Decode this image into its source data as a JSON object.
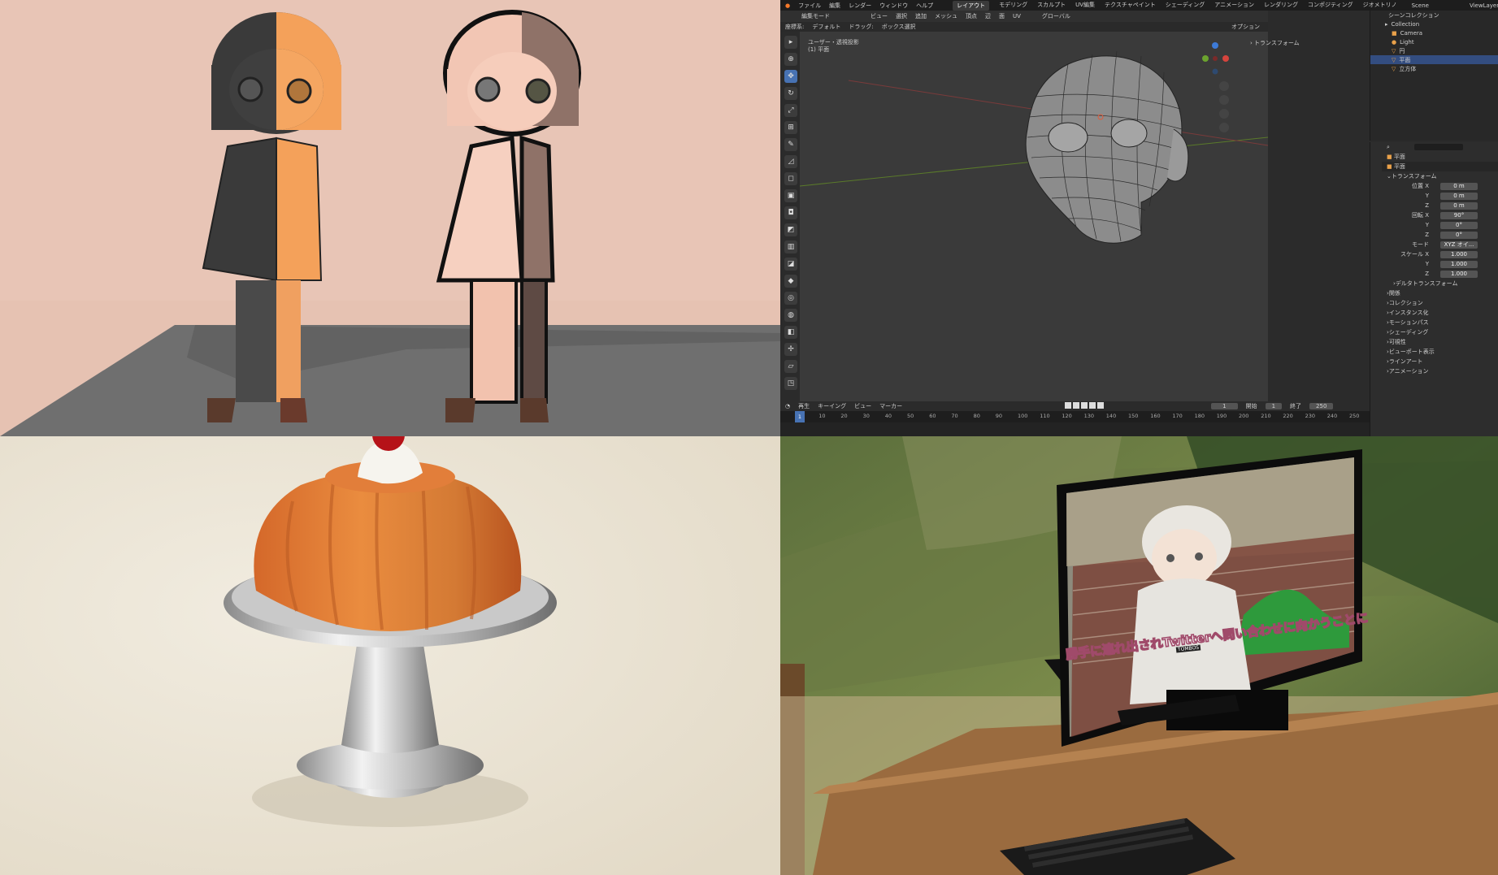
{
  "blender": {
    "menu": [
      "ファイル",
      "編集",
      "レンダー",
      "ウィンドウ",
      "ヘルプ"
    ],
    "workspaces": [
      "レイアウト",
      "モデリング",
      "スカルプト",
      "UV編集",
      "テクスチャペイント",
      "シェーディング",
      "アニメーション",
      "レンダリング",
      "コンポジティング",
      "ジオメトリノ"
    ],
    "active_workspace": "レイアウト",
    "scene": "Scene",
    "view_layer": "ViewLayer",
    "header_mode": "編集モード",
    "header_menus": [
      "ビュー",
      "選択",
      "追加",
      "メッシュ",
      "頂点",
      "辺",
      "面",
      "UV"
    ],
    "transform_orient": "グローバル",
    "header2": {
      "coord": "座標系:",
      "default": "デフォルト",
      "drag": "ドラッグ:",
      "box": "ボックス選択",
      "options": "オプション"
    },
    "viewport_label_1": "ユーザー・透視投影",
    "viewport_label_2": "(1) 平面",
    "transform_panel": "トランスフォーム",
    "outliner": {
      "title": "シーンコレクション",
      "items": [
        "Collection",
        "Camera",
        "Light",
        "円",
        "平面",
        "立方体"
      ]
    },
    "props": {
      "search": "",
      "object": "平面",
      "data_name": "平面",
      "section": "トランスフォーム",
      "loc_x_lab": "位置 X",
      "loc_x": "0 m",
      "loc_y_lab": "Y",
      "loc_y": "0 m",
      "loc_z_lab": "Z",
      "loc_z": "0 m",
      "rot_x_lab": "回転 X",
      "rot_x": "90°",
      "rot_y_lab": "Y",
      "rot_y": "0°",
      "rot_z_lab": "Z",
      "rot_z": "0°",
      "mode_lab": "モード",
      "mode": "XYZ オイ...",
      "scale_x_lab": "スケール X",
      "scale_x": "1.000",
      "scale_y_lab": "Y",
      "scale_y": "1.000",
      "scale_z_lab": "Z",
      "scale_z": "1.000",
      "sections": [
        "デルタトランスフォーム",
        "関係",
        "コレクション",
        "インスタンス化",
        "モーションパス",
        "シェーディング",
        "可視性",
        "ビューポート表示",
        "ラインアート",
        "アニメーション"
      ]
    },
    "timeline": {
      "menus": [
        "再生",
        "キーイング",
        "ビュー",
        "マーカー"
      ],
      "current": "1",
      "start_lab": "開始",
      "start": "1",
      "end_lab": "終了",
      "end": "250",
      "ticks": [
        "1",
        "10",
        "20",
        "30",
        "40",
        "50",
        "60",
        "70",
        "80",
        "90",
        "100",
        "110",
        "120",
        "130",
        "140",
        "150",
        "160",
        "170",
        "180",
        "190",
        "200",
        "210",
        "220",
        "230",
        "240",
        "250"
      ]
    }
  },
  "monitor": {
    "subtitle": "勝手に連れ出されTwitterへ問い合わせに向かうことに",
    "hoodie_text": "TOMBOS"
  },
  "colors": {
    "peach_bg": "#e8c6b8",
    "orange": "#f2a35c",
    "blender_bg": "#3a3a3a",
    "accent": "#4772b3",
    "jelly": "#d9742a",
    "desk": "#9a6b3f"
  }
}
